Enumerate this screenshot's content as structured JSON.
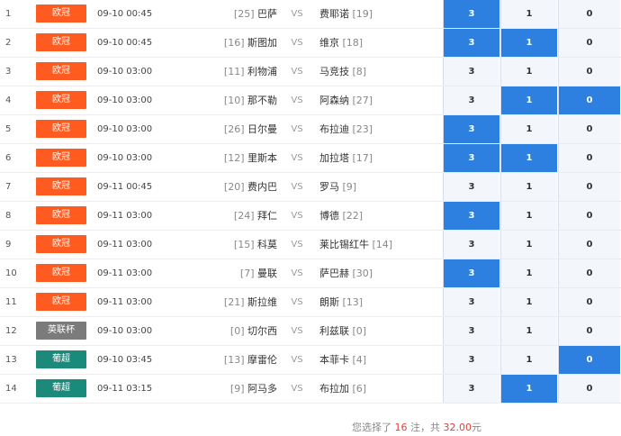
{
  "matches": [
    {
      "index": "1",
      "league": "欧冠",
      "league_color": "#ff5a1f",
      "time": "09-10 00:45",
      "home_rank": "[25]",
      "home": "巴萨",
      "vs": "VS",
      "away": "费耶诺",
      "away_rank": "[19]",
      "options": [
        "3",
        "1",
        "0"
      ],
      "selected": [
        true,
        false,
        false
      ]
    },
    {
      "index": "2",
      "league": "欧冠",
      "league_color": "#ff5a1f",
      "time": "09-10 00:45",
      "home_rank": "[16]",
      "home": "斯图加",
      "vs": "VS",
      "away": "维京",
      "away_rank": "[18]",
      "options": [
        "3",
        "1",
        "0"
      ],
      "selected": [
        true,
        true,
        false
      ]
    },
    {
      "index": "3",
      "league": "欧冠",
      "league_color": "#ff5a1f",
      "time": "09-10 03:00",
      "home_rank": "[11]",
      "home": "利物浦",
      "vs": "VS",
      "away": "马竞技",
      "away_rank": "[8]",
      "options": [
        "3",
        "1",
        "0"
      ],
      "selected": [
        false,
        false,
        false
      ]
    },
    {
      "index": "4",
      "league": "欧冠",
      "league_color": "#ff5a1f",
      "time": "09-10 03:00",
      "home_rank": "[10]",
      "home": "那不勒",
      "vs": "VS",
      "away": "阿森纳",
      "away_rank": "[27]",
      "options": [
        "3",
        "1",
        "0"
      ],
      "selected": [
        false,
        true,
        true
      ]
    },
    {
      "index": "5",
      "league": "欧冠",
      "league_color": "#ff5a1f",
      "time": "09-10 03:00",
      "home_rank": "[26]",
      "home": "日尔曼",
      "vs": "VS",
      "away": "布拉迪",
      "away_rank": "[23]",
      "options": [
        "3",
        "1",
        "0"
      ],
      "selected": [
        true,
        false,
        false
      ]
    },
    {
      "index": "6",
      "league": "欧冠",
      "league_color": "#ff5a1f",
      "time": "09-10 03:00",
      "home_rank": "[12]",
      "home": "里斯本",
      "vs": "VS",
      "away": "加拉塔",
      "away_rank": "[17]",
      "options": [
        "3",
        "1",
        "0"
      ],
      "selected": [
        true,
        true,
        false
      ]
    },
    {
      "index": "7",
      "league": "欧冠",
      "league_color": "#ff5a1f",
      "time": "09-11 00:45",
      "home_rank": "[20]",
      "home": "费内巴",
      "vs": "VS",
      "away": "罗马",
      "away_rank": "[9]",
      "options": [
        "3",
        "1",
        "0"
      ],
      "selected": [
        false,
        false,
        false
      ]
    },
    {
      "index": "8",
      "league": "欧冠",
      "league_color": "#ff5a1f",
      "time": "09-11 03:00",
      "home_rank": "[24]",
      "home": "拜仁",
      "vs": "VS",
      "away": "博德",
      "away_rank": "[22]",
      "options": [
        "3",
        "1",
        "0"
      ],
      "selected": [
        true,
        false,
        false
      ]
    },
    {
      "index": "9",
      "league": "欧冠",
      "league_color": "#ff5a1f",
      "time": "09-11 03:00",
      "home_rank": "[15]",
      "home": "科莫",
      "vs": "VS",
      "away": "莱比锡红牛",
      "away_rank": "[14]",
      "options": [
        "3",
        "1",
        "0"
      ],
      "selected": [
        false,
        false,
        false
      ]
    },
    {
      "index": "10",
      "league": "欧冠",
      "league_color": "#ff5a1f",
      "time": "09-11 03:00",
      "home_rank": "[7]",
      "home": "曼联",
      "vs": "VS",
      "away": "萨巴赫",
      "away_rank": "[30]",
      "options": [
        "3",
        "1",
        "0"
      ],
      "selected": [
        true,
        false,
        false
      ]
    },
    {
      "index": "11",
      "league": "欧冠",
      "league_color": "#ff5a1f",
      "time": "09-11 03:00",
      "home_rank": "[21]",
      "home": "斯拉维",
      "vs": "VS",
      "away": "朗斯",
      "away_rank": "[13]",
      "options": [
        "3",
        "1",
        "0"
      ],
      "selected": [
        false,
        false,
        false
      ]
    },
    {
      "index": "12",
      "league": "英联杯",
      "league_color": "#7b7b7b",
      "time": "09-10 03:00",
      "home_rank": "[0]",
      "home": "切尔西",
      "vs": "VS",
      "away": "利兹联",
      "away_rank": "[0]",
      "options": [
        "3",
        "1",
        "0"
      ],
      "selected": [
        false,
        false,
        false
      ]
    },
    {
      "index": "13",
      "league": "葡超",
      "league_color": "#1b8a7a",
      "time": "09-10 03:45",
      "home_rank": "[13]",
      "home": "摩雷伦",
      "vs": "VS",
      "away": "本菲卡",
      "away_rank": "[4]",
      "options": [
        "3",
        "1",
        "0"
      ],
      "selected": [
        false,
        false,
        true
      ]
    },
    {
      "index": "14",
      "league": "葡超",
      "league_color": "#1b8a7a",
      "time": "09-11 03:15",
      "home_rank": "[9]",
      "home": "阿马多",
      "vs": "VS",
      "away": "布拉加",
      "away_rank": "[6]",
      "options": [
        "3",
        "1",
        "0"
      ],
      "selected": [
        false,
        true,
        false
      ]
    }
  ],
  "summary": {
    "prefix": "您选择了",
    "count": "16",
    "mid": "注，共",
    "amount": "32.00",
    "unit": "元"
  }
}
